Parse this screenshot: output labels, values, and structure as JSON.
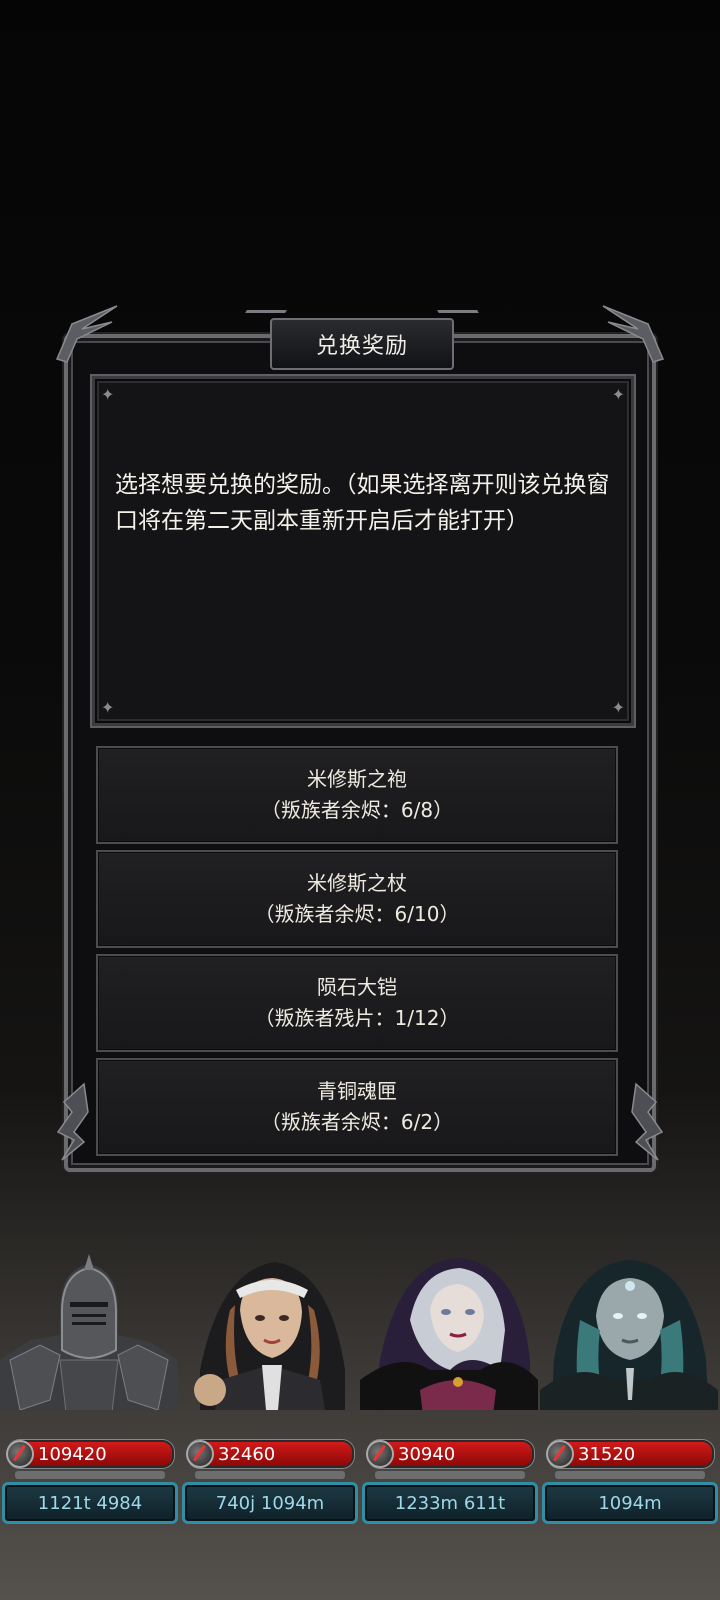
{
  "dialog": {
    "title": "兑换奖励",
    "description": "选择想要兑换的奖励。（如果选择离开则该兑换窗口将在第二天副本重新开启后才能打开）",
    "options": [
      {
        "name": "米修斯之袍",
        "cost": "（叛族者余烬：6/8）"
      },
      {
        "name": "米修斯之杖",
        "cost": "（叛族者余烬：6/10）"
      },
      {
        "name": "陨石大铠",
        "cost": "（叛族者残片：1/12）"
      },
      {
        "name": "青铜魂匣",
        "cost": "（叛族者余烬：6/2）"
      }
    ]
  },
  "heroes": [
    {
      "portrait": "armored-knight-portrait",
      "hp": "109420",
      "stat": "1121t 4984"
    },
    {
      "portrait": "nun-warrior-portrait",
      "hp": "32460",
      "stat": "740j 1094m"
    },
    {
      "portrait": "hooded-sorceress-portrait",
      "hp": "30940",
      "stat": "1233m 611t"
    },
    {
      "portrait": "hooded-priestess-portrait",
      "hp": "31520",
      "stat": "1094m"
    }
  ],
  "colors": {
    "hp_bar": "#c41414",
    "stat_border": "#2f8fa6",
    "stat_text": "#9fd8e8"
  }
}
